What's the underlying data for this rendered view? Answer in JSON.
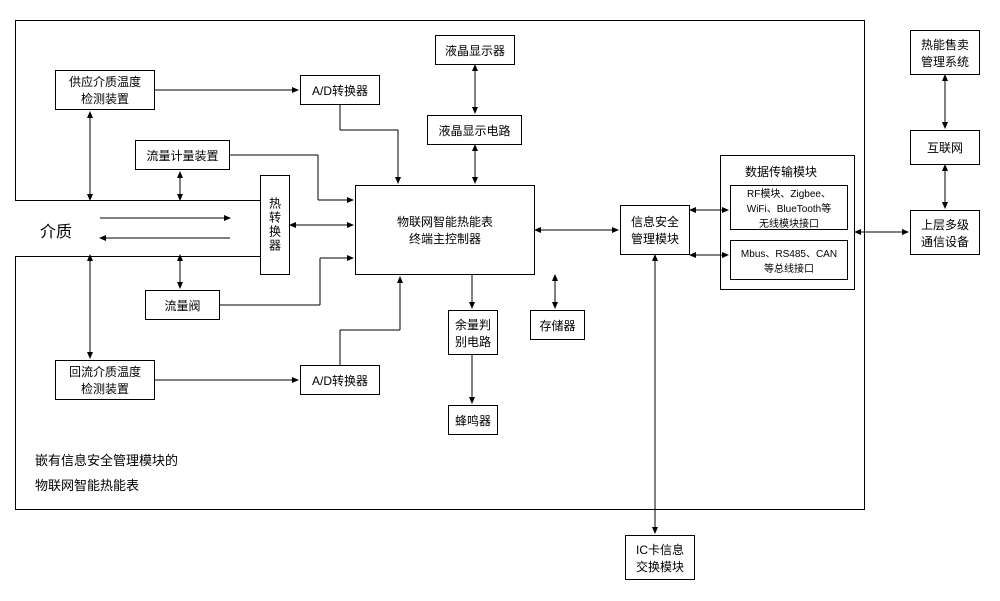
{
  "diagram": {
    "main_container_label_line1": "嵌有信息安全管理模块的",
    "main_container_label_line2": "物联网智能热能表",
    "boxes": {
      "supply_temp": "供应介质温度\n检测装置",
      "ad_converter_top": "A/D转换器",
      "lcd_display": "液晶显示器",
      "lcd_circuit": "液晶显示电路",
      "flow_meter": "流量计量装置",
      "heat_converter": "热转换器",
      "medium": "介质",
      "flow_valve": "流量阀",
      "main_controller": "物联网智能热能表\n终端主控制器",
      "info_security": "信息安全\n管理模块",
      "data_transfer_title": "数据传输模块",
      "rf_module": "RF模块、Zigbee、\nWiFi、BlueTooth等\n无线模块接口",
      "bus_interface": "Mbus、RS485、CAN\n等总线接口",
      "return_temp": "回流介质温度\n检测装置",
      "ad_converter_bottom": "A/D转换器",
      "balance_circuit": "余量判\n别电路",
      "storage": "存储器",
      "buzzer": "蜂鸣器",
      "ic_card": "IC卡信息\n交换模块",
      "heat_sale": "热能售卖\n管理系统",
      "internet": "互联网",
      "upper_comm": "上层多级\n通信设备"
    }
  }
}
